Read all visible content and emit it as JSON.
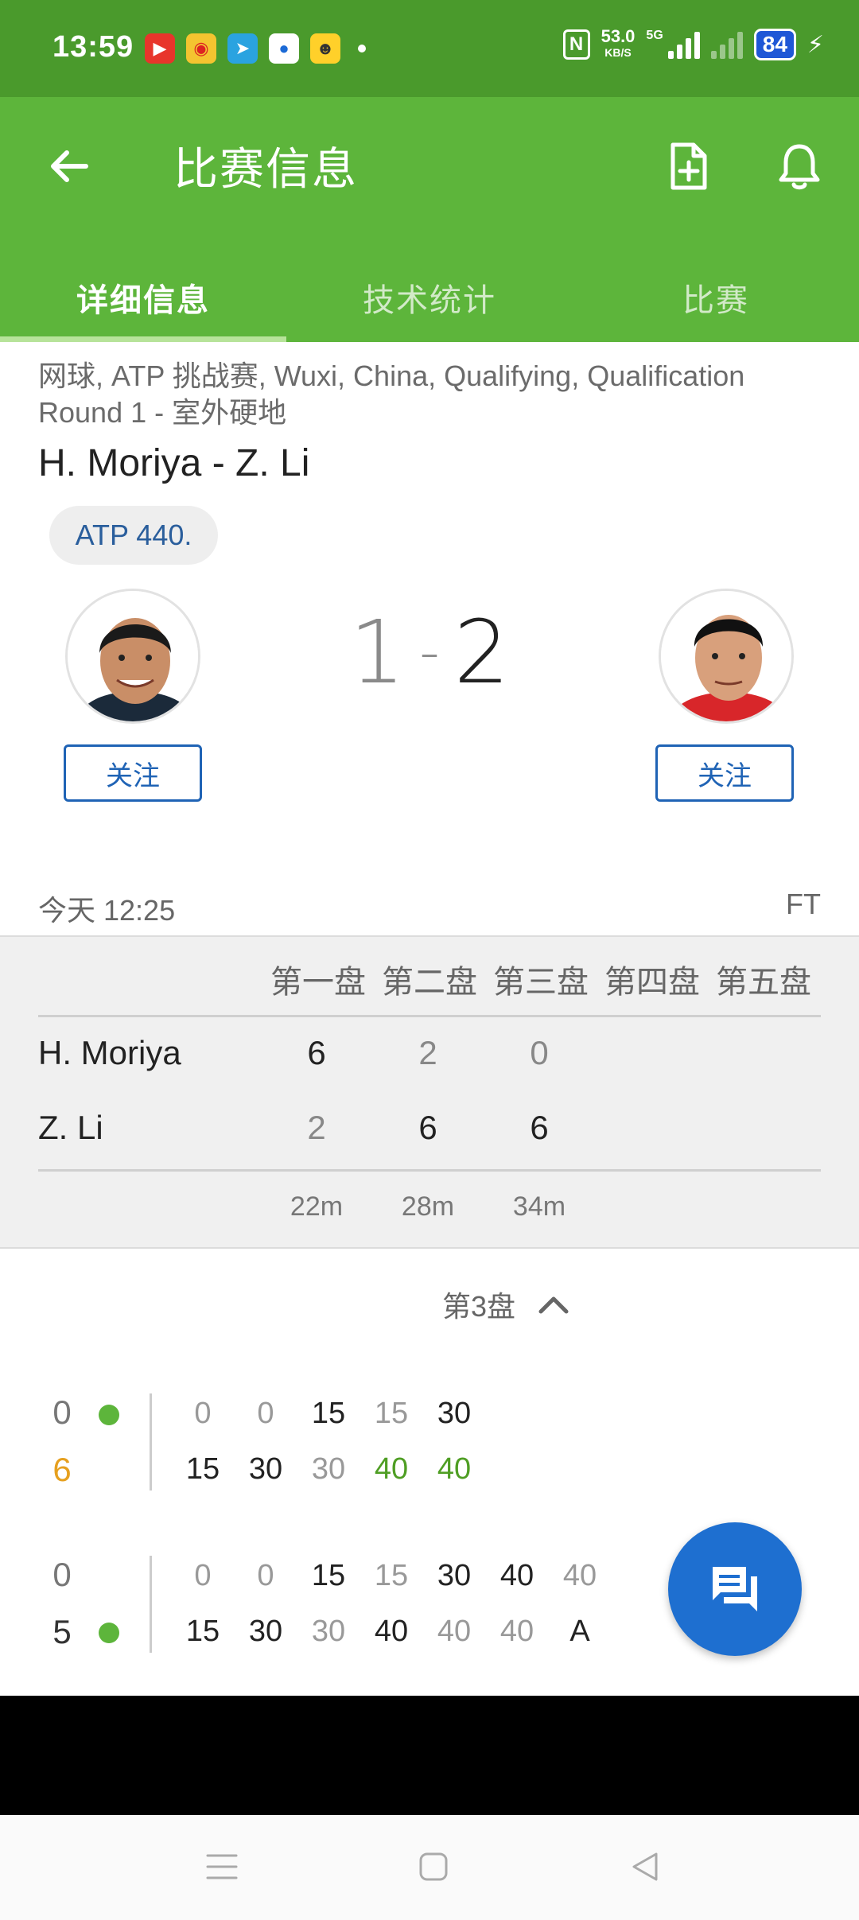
{
  "status_bar": {
    "time": "13:59",
    "net_speed": "53.0",
    "net_unit": "KB/S",
    "network": "5G",
    "battery": "84",
    "icons": [
      "video-app-icon",
      "weibo-icon",
      "telegram-icon",
      "map-app-icon",
      "chat-app-icon",
      "nfc-icon",
      "signal-icon",
      "battery-icon",
      "charging-icon"
    ]
  },
  "app_bar": {
    "title": "比赛信息",
    "back_icon": "arrow-left-icon",
    "doc_icon": "document-add-icon",
    "bell_icon": "bell-icon"
  },
  "tabs": [
    {
      "label": "详细信息",
      "active": true
    },
    {
      "label": "技术统计",
      "active": false
    },
    {
      "label": "比赛",
      "active": false
    }
  ],
  "match": {
    "meta": "网球, ATP 挑战赛, Wuxi, China, Qualifying, Qualification Round 1 - 室外硬地",
    "title": "H. Moriya - Z. Li",
    "rank_chip": "ATP 440.",
    "score_home": "1",
    "score_sep": "-",
    "score_away": "2",
    "follow_label": "关注",
    "date": "今天 12:25",
    "status": "FT"
  },
  "sets_table": {
    "headers": [
      "第一盘",
      "第二盘",
      "第三盘",
      "第四盘",
      "第五盘"
    ],
    "players": [
      {
        "name": "H. Moriya",
        "sets": [
          "6",
          "2",
          "0"
        ]
      },
      {
        "name": "Z. Li",
        "sets": [
          "2",
          "6",
          "6"
        ]
      }
    ],
    "durations": [
      "22m",
      "28m",
      "34m"
    ]
  },
  "set_detail": {
    "label": "第3盘",
    "toggle_icon": "chevron-up-icon",
    "games": [
      {
        "top_score": "0",
        "bottom_score": "6",
        "server": "top",
        "top_points": [
          "0",
          "0",
          "15",
          "15",
          "30"
        ],
        "bottom_points": [
          "15",
          "30",
          "30",
          "40",
          "40"
        ]
      },
      {
        "top_score": "0",
        "bottom_score": "5",
        "server": "bottom",
        "top_points": [
          "0",
          "0",
          "15",
          "15",
          "30",
          "40",
          "40"
        ],
        "bottom_points": [
          "15",
          "30",
          "30",
          "40",
          "40",
          "40",
          "A"
        ]
      }
    ]
  },
  "fab_icon": "chat-icon",
  "nav": {
    "menu_icon": "menu-icon",
    "home_icon": "home-icon",
    "back_icon": "back-triangle-icon"
  },
  "colors": {
    "appbar": "#5db53b",
    "statusbar": "#4a9a2c",
    "accent_blue": "#1e6fd0",
    "gold": "#e6a01f"
  }
}
